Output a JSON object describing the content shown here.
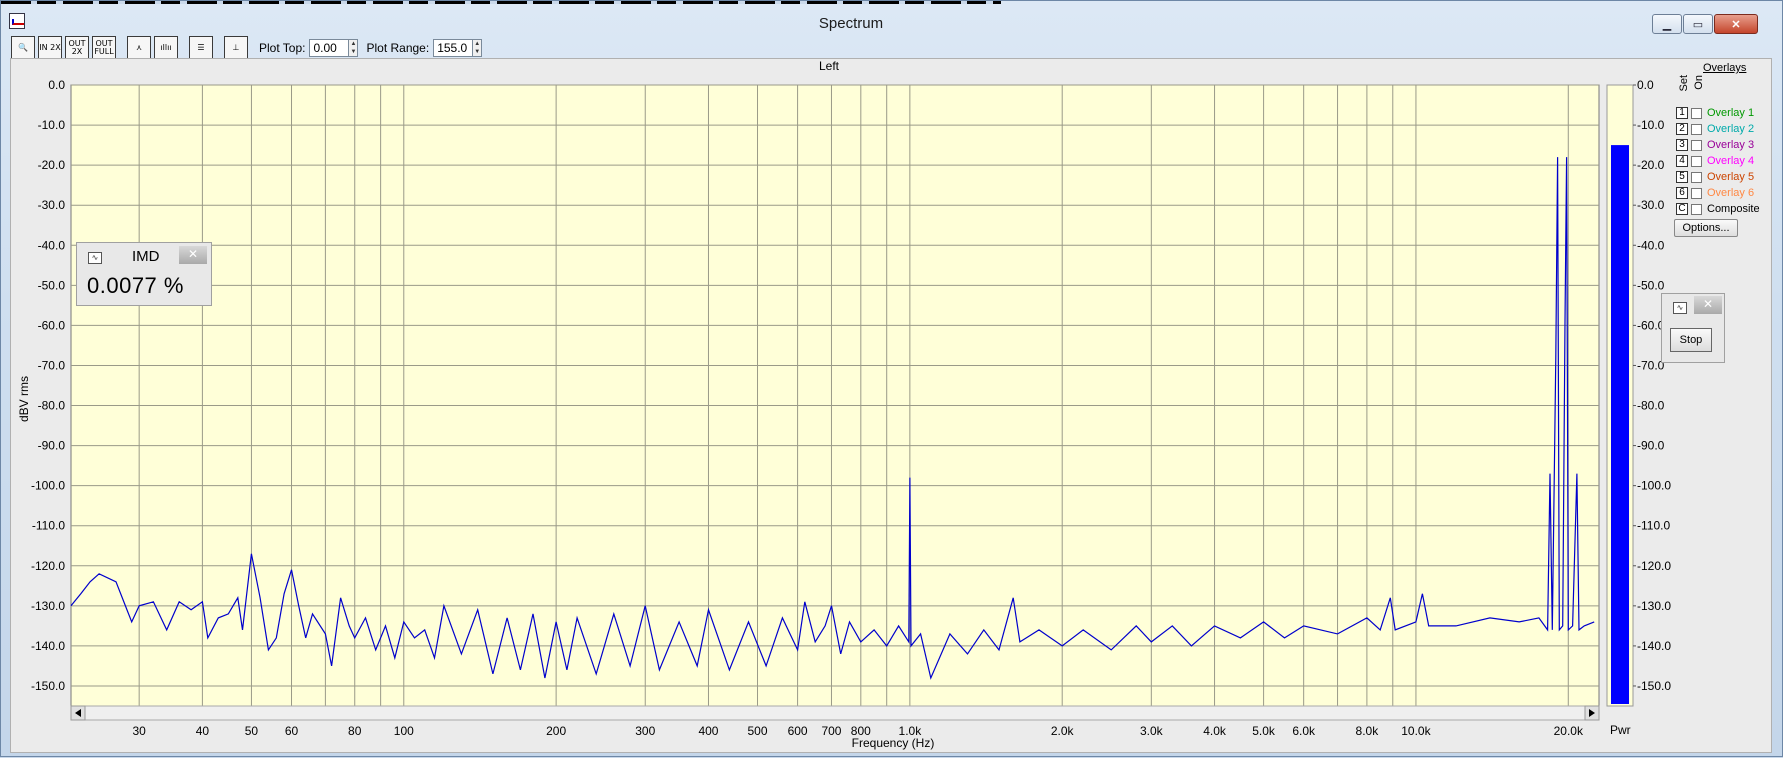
{
  "window": {
    "title": "Spectrum"
  },
  "titlebar_buttons": {
    "minimize": "▁",
    "maximize": "▭",
    "close": "✕"
  },
  "toolbar": {
    "buttons": [
      {
        "name": "zoom-button",
        "label": "🔍"
      },
      {
        "name": "in-2x-button",
        "label": "IN 2X"
      },
      {
        "name": "out-2x-button",
        "label": "OUT 2X"
      },
      {
        "name": "out-full-button",
        "label": "OUT FULL"
      },
      {
        "name": "peak-button",
        "label": "⋏"
      },
      {
        "name": "bars-button",
        "label": "ıllıı"
      },
      {
        "name": "list-button",
        "label": "☰"
      },
      {
        "name": "cursor-button",
        "label": "⊥"
      }
    ],
    "plot_top_label": "Plot Top:",
    "plot_top_value": "0.00",
    "plot_range_label": "Plot Range:",
    "plot_range_value": "155.0"
  },
  "plot": {
    "channel_title": "Left",
    "bg_color": "#ffffd8",
    "trace_color": "#0000cc",
    "meter_label": "Pwr",
    "meter_level_db": -15
  },
  "imd_panel": {
    "title": "IMD",
    "value": "0.0077 %"
  },
  "stop_panel": {
    "button_label": "Stop"
  },
  "overlays": {
    "title": "Overlays",
    "set_header": "Set",
    "on_header": "On",
    "items": [
      {
        "set": "1",
        "label": "Overlay 1",
        "color": "#009900"
      },
      {
        "set": "2",
        "label": "Overlay 2",
        "color": "#00aaaa"
      },
      {
        "set": "3",
        "label": "Overlay 3",
        "color": "#990099"
      },
      {
        "set": "4",
        "label": "Overlay 4",
        "color": "#ff00ff"
      },
      {
        "set": "5",
        "label": "Overlay 5",
        "color": "#cc4400"
      },
      {
        "set": "6",
        "label": "Overlay 6",
        "color": "#ff8844"
      },
      {
        "set": "C",
        "label": "Composite",
        "color": "#000000"
      }
    ],
    "options_label": "Options..."
  },
  "chart_data": {
    "type": "line",
    "title": "Left",
    "xlabel": "Frequency (Hz)",
    "ylabel": "dBV rms",
    "xscale": "log",
    "xlim": [
      22,
      23000
    ],
    "ylim": [
      -155,
      0
    ],
    "y_ticks": [
      "0.0",
      "-10.0",
      "-20.0",
      "-30.0",
      "-40.0",
      "-50.0",
      "-60.0",
      "-70.0",
      "-80.0",
      "-90.0",
      "-100.0",
      "-110.0",
      "-120.0",
      "-130.0",
      "-140.0",
      "-150.0"
    ],
    "x_tick_labels": [
      {
        "f": 30,
        "label": "30"
      },
      {
        "f": 40,
        "label": "40"
      },
      {
        "f": 50,
        "label": "50"
      },
      {
        "f": 60,
        "label": "60"
      },
      {
        "f": 80,
        "label": "80"
      },
      {
        "f": 100,
        "label": "100"
      },
      {
        "f": 200,
        "label": "200"
      },
      {
        "f": 300,
        "label": "300"
      },
      {
        "f": 400,
        "label": "400"
      },
      {
        "f": 500,
        "label": "500"
      },
      {
        "f": 600,
        "label": "600"
      },
      {
        "f": 700,
        "label": "700"
      },
      {
        "f": 800,
        "label": "800"
      },
      {
        "f": 1000,
        "label": "1.0k"
      },
      {
        "f": 2000,
        "label": "2.0k"
      },
      {
        "f": 3000,
        "label": "3.0k"
      },
      {
        "f": 4000,
        "label": "4.0k"
      },
      {
        "f": 5000,
        "label": "5.0k"
      },
      {
        "f": 6000,
        "label": "6.0k"
      },
      {
        "f": 8000,
        "label": "8.0k"
      },
      {
        "f": 10000,
        "label": "10.0k"
      },
      {
        "f": 20000,
        "label": "20.0k"
      }
    ],
    "grid": true,
    "series": [
      {
        "color": "#0000cc",
        "points": [
          [
            22,
            -130
          ],
          [
            23,
            -127
          ],
          [
            24,
            -124
          ],
          [
            25,
            -122
          ],
          [
            27,
            -124
          ],
          [
            29,
            -134
          ],
          [
            30,
            -130
          ],
          [
            32,
            -129
          ],
          [
            34,
            -136
          ],
          [
            36,
            -129
          ],
          [
            38,
            -131
          ],
          [
            40,
            -129
          ],
          [
            41,
            -138
          ],
          [
            43,
            -133
          ],
          [
            45,
            -132
          ],
          [
            47,
            -128
          ],
          [
            48,
            -136
          ],
          [
            50,
            -117
          ],
          [
            52,
            -128
          ],
          [
            54,
            -141
          ],
          [
            56,
            -138
          ],
          [
            58,
            -127
          ],
          [
            60,
            -121
          ],
          [
            62,
            -130
          ],
          [
            64,
            -138
          ],
          [
            66,
            -132
          ],
          [
            70,
            -137
          ],
          [
            72,
            -145
          ],
          [
            75,
            -128
          ],
          [
            78,
            -135
          ],
          [
            80,
            -138
          ],
          [
            84,
            -133
          ],
          [
            88,
            -141
          ],
          [
            92,
            -135
          ],
          [
            96,
            -143
          ],
          [
            100,
            -134
          ],
          [
            105,
            -138
          ],
          [
            110,
            -136
          ],
          [
            115,
            -143
          ],
          [
            120,
            -130
          ],
          [
            130,
            -142
          ],
          [
            140,
            -131
          ],
          [
            150,
            -147
          ],
          [
            160,
            -133
          ],
          [
            170,
            -146
          ],
          [
            180,
            -132
          ],
          [
            190,
            -148
          ],
          [
            200,
            -134
          ],
          [
            210,
            -146
          ],
          [
            220,
            -133
          ],
          [
            240,
            -147
          ],
          [
            260,
            -132
          ],
          [
            280,
            -145
          ],
          [
            300,
            -130
          ],
          [
            320,
            -146
          ],
          [
            350,
            -134
          ],
          [
            380,
            -145
          ],
          [
            400,
            -131
          ],
          [
            440,
            -146
          ],
          [
            480,
            -134
          ],
          [
            520,
            -145
          ],
          [
            560,
            -133
          ],
          [
            600,
            -141
          ],
          [
            620,
            -129
          ],
          [
            650,
            -139
          ],
          [
            680,
            -135
          ],
          [
            700,
            -130
          ],
          [
            730,
            -142
          ],
          [
            760,
            -134
          ],
          [
            800,
            -139
          ],
          [
            850,
            -136
          ],
          [
            900,
            -140
          ],
          [
            950,
            -135
          ],
          [
            995,
            -139
          ],
          [
            1000,
            -98
          ],
          [
            1005,
            -140
          ],
          [
            1050,
            -137
          ],
          [
            1100,
            -148
          ],
          [
            1200,
            -137
          ],
          [
            1300,
            -142
          ],
          [
            1400,
            -136
          ],
          [
            1500,
            -141
          ],
          [
            1600,
            -128
          ],
          [
            1650,
            -139
          ],
          [
            1800,
            -136
          ],
          [
            2000,
            -140
          ],
          [
            2200,
            -136
          ],
          [
            2500,
            -141
          ],
          [
            2800,
            -135
          ],
          [
            3000,
            -139
          ],
          [
            3300,
            -135
          ],
          [
            3600,
            -140
          ],
          [
            4000,
            -135
          ],
          [
            4500,
            -138
          ],
          [
            5000,
            -134
          ],
          [
            5500,
            -138
          ],
          [
            6000,
            -135
          ],
          [
            7000,
            -137
          ],
          [
            8000,
            -133
          ],
          [
            8500,
            -136
          ],
          [
            8900,
            -128
          ],
          [
            9100,
            -136
          ],
          [
            10000,
            -134
          ],
          [
            10300,
            -127
          ],
          [
            10600,
            -135
          ],
          [
            12000,
            -135
          ],
          [
            14000,
            -133
          ],
          [
            16000,
            -134
          ],
          [
            17500,
            -133
          ],
          [
            18200,
            -136
          ],
          [
            18400,
            -97
          ],
          [
            18600,
            -136
          ],
          [
            18900,
            -68
          ],
          [
            19050,
            -18
          ],
          [
            19200,
            -136
          ],
          [
            19500,
            -135
          ],
          [
            19700,
            -59
          ],
          [
            19850,
            -18
          ],
          [
            20000,
            -136
          ],
          [
            20400,
            -135
          ],
          [
            20800,
            -97
          ],
          [
            21000,
            -136
          ],
          [
            21500,
            -135
          ],
          [
            22500,
            -134
          ]
        ]
      }
    ]
  }
}
